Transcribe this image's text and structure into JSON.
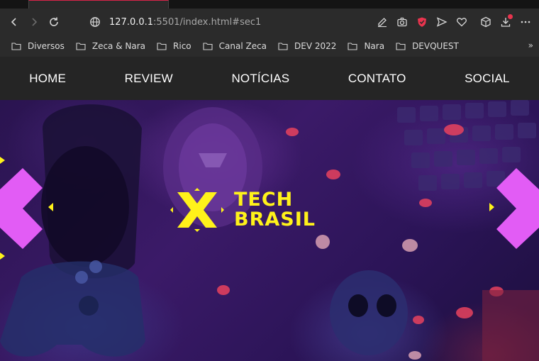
{
  "browser": {
    "url_host": "127.0.0.1",
    "url_path": ":5501/index.html#sec1",
    "bookmarks": [
      {
        "label": "Diversos"
      },
      {
        "label": "Zeca & Nara"
      },
      {
        "label": "Rico"
      },
      {
        "label": "Canal Zeca"
      },
      {
        "label": "DEV 2022"
      },
      {
        "label": "Nara"
      },
      {
        "label": "DEVQUEST"
      }
    ],
    "more_label": "»"
  },
  "nav": {
    "items": [
      {
        "label": "HOME"
      },
      {
        "label": "REVIEW"
      },
      {
        "label": "NOTÍCIAS"
      },
      {
        "label": "CONTATO"
      },
      {
        "label": "SOCIAL"
      }
    ]
  },
  "hero": {
    "logo_line1": "TECH",
    "logo_line2": "BRASIL",
    "accent_color": "#fff21a",
    "arrow_color": "#e25cf5"
  }
}
